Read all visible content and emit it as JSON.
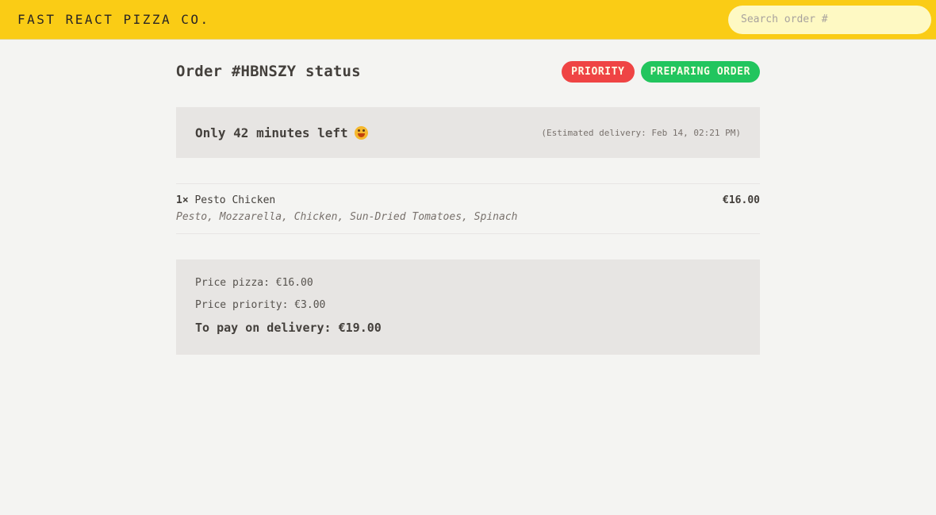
{
  "header": {
    "logo": "FAST REACT PIZZA CO.",
    "search_placeholder": "Search order #"
  },
  "order": {
    "title": "Order #HBNSZY status",
    "badges": {
      "priority": "PRIORITY",
      "status": "PREPARING ORDER"
    },
    "eta": {
      "remaining": "Only 42 minutes left",
      "emoji": "grinning-face-icon",
      "estimated": "(Estimated delivery: Feb 14, 02:21 PM)"
    },
    "items": [
      {
        "qty": "1×",
        "name": "Pesto Chicken",
        "price": "€16.00",
        "ingredients": "Pesto, Mozzarella, Chicken, Sun-Dried Tomatoes, Spinach"
      }
    ],
    "summary": {
      "price_pizza": "Price pizza: €16.00",
      "price_priority": "Price priority: €3.00",
      "to_pay": "To pay on delivery: €19.00"
    }
  },
  "colors": {
    "header_bg": "#facc15",
    "priority_badge": "#ef4444",
    "status_badge": "#22c55e",
    "panel_bg": "#e7e5e3"
  }
}
